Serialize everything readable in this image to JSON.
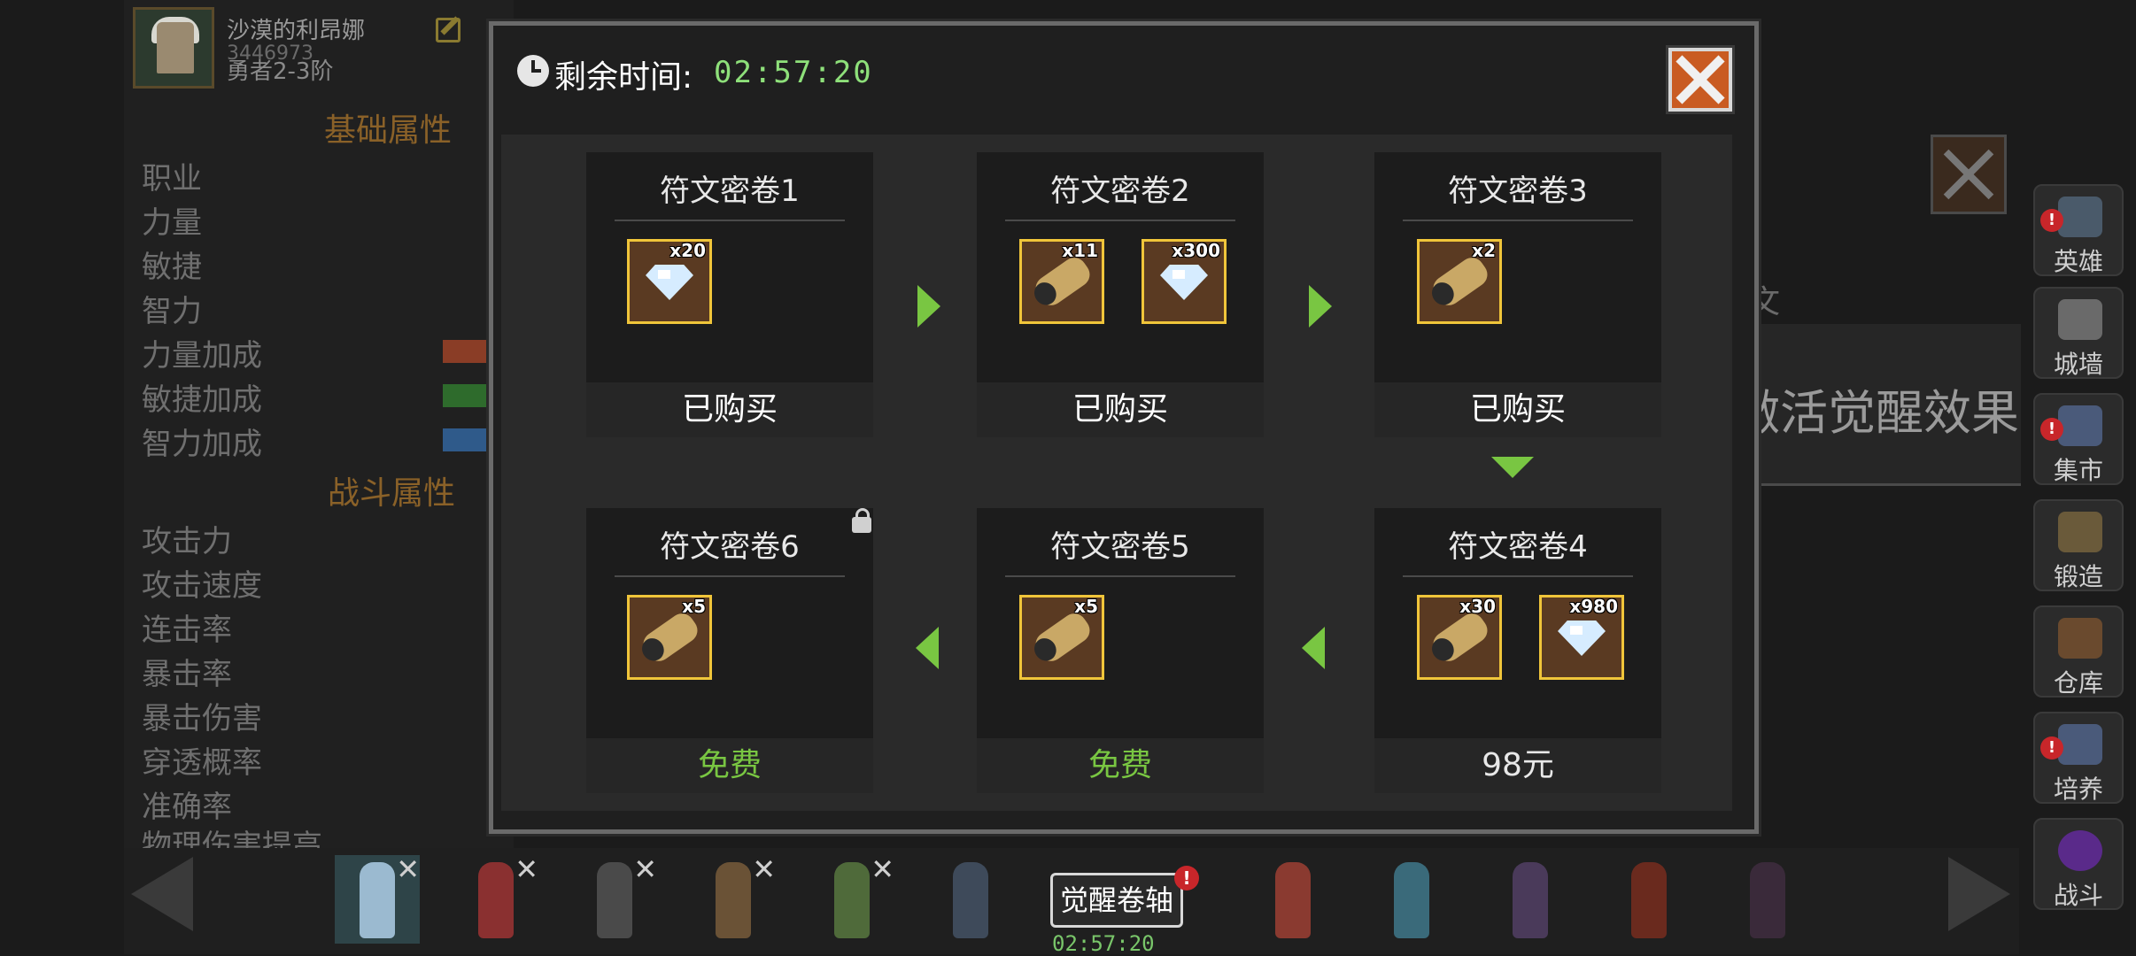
{
  "hero": {
    "name": "沙漠的利昂娜",
    "id": "3446973",
    "rank": "勇者2-3阶"
  },
  "attributes": {
    "basic_title": "基础属性",
    "basic": [
      "职业",
      "力量",
      "敏捷",
      "智力",
      "力量加成",
      "敏捷加成",
      "智力加成"
    ],
    "combat_title": "战斗属性",
    "combat": [
      "攻击力",
      "攻击速度",
      "连击率",
      "暴击率",
      "暴击伤害",
      "穿透概率",
      "准确率",
      "物理伤害提高"
    ],
    "bar_colors": [
      "#8a3d26",
      "#2e6b2c",
      "#2f5a8a"
    ]
  },
  "background": {
    "partial_text": "文",
    "partial_banner": "激活觉醒效果"
  },
  "modal": {
    "timer_label": "剩余时间:",
    "timer_value": "02:57:20",
    "cards": [
      {
        "title": "符文密卷1",
        "items": [
          {
            "type": "gem",
            "qty": "x20"
          }
        ],
        "footer": "已购买",
        "footer_color": "#ffffff"
      },
      {
        "title": "符文密卷2",
        "items": [
          {
            "type": "scroll",
            "qty": "x11"
          },
          {
            "type": "gem",
            "qty": "x300"
          }
        ],
        "footer": "已购买",
        "footer_color": "#ffffff"
      },
      {
        "title": "符文密卷3",
        "items": [
          {
            "type": "scroll",
            "qty": "x2"
          }
        ],
        "footer": "已购买",
        "footer_color": "#ffffff"
      },
      {
        "title": "符文密卷4",
        "items": [
          {
            "type": "scroll",
            "qty": "x30"
          },
          {
            "type": "gem",
            "qty": "x980"
          }
        ],
        "footer": "98元",
        "footer_color": "#e8e8e8"
      },
      {
        "title": "符文密卷5",
        "items": [
          {
            "type": "scroll",
            "qty": "x5"
          }
        ],
        "footer": "免费",
        "footer_color": "#79c642"
      },
      {
        "title": "符文密卷6",
        "items": [
          {
            "type": "scroll",
            "qty": "x5"
          }
        ],
        "footer": "免费",
        "footer_color": "#79c642",
        "locked": true
      }
    ],
    "accent_color": "#79c642"
  },
  "side_menu": [
    {
      "label": "英雄",
      "icon": "hero-helmet-icon",
      "alert": "!"
    },
    {
      "label": "城墙",
      "icon": "castle-wall-icon"
    },
    {
      "label": "集市",
      "icon": "market-merchant-icon",
      "alert": "!"
    },
    {
      "label": "锻造",
      "icon": "anvil-icon"
    },
    {
      "label": "仓库",
      "icon": "warehouse-cart-icon"
    },
    {
      "label": "培养",
      "icon": "trophy-cup-icon",
      "alert": "!"
    },
    {
      "label": "战斗",
      "icon": "portal-vortex-icon"
    }
  ],
  "bottom_bar": {
    "awaken_label": "觉醒卷轴",
    "awaken_alert": "!",
    "awaken_timer": "02:57:20",
    "remove_mark": "✕"
  }
}
